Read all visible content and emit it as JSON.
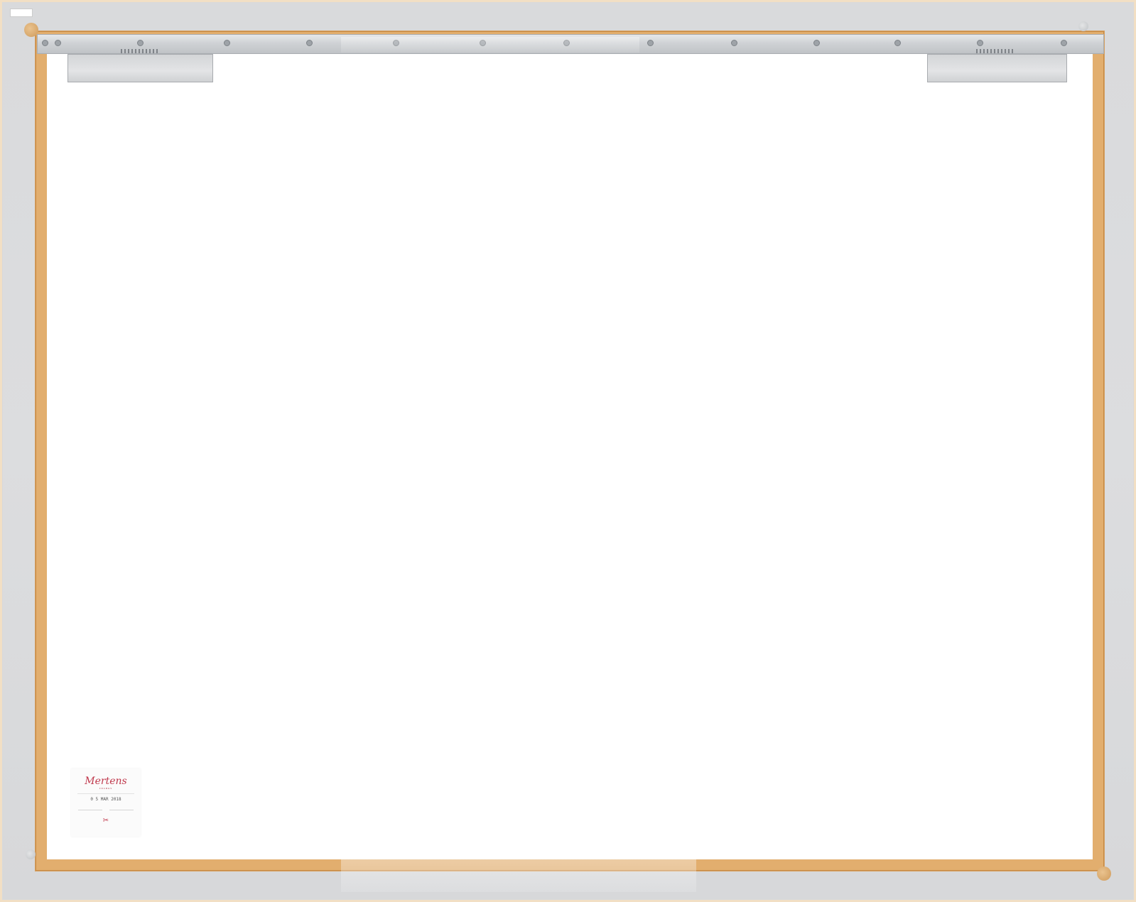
{
  "label": {
    "brand": "Mertens",
    "subtitle": "FRAMES",
    "date": "0 5 MAR 2018"
  },
  "sticker": {
    "code": ""
  },
  "colors": {
    "frame_wood": "#e2ae6e",
    "backing_grey": "#d9dadc",
    "board_white": "#ffffff",
    "rail_metal": "#cfd2d5",
    "label_accent": "#c0394d"
  },
  "icons": {
    "label_mark": "scissors-icon"
  }
}
